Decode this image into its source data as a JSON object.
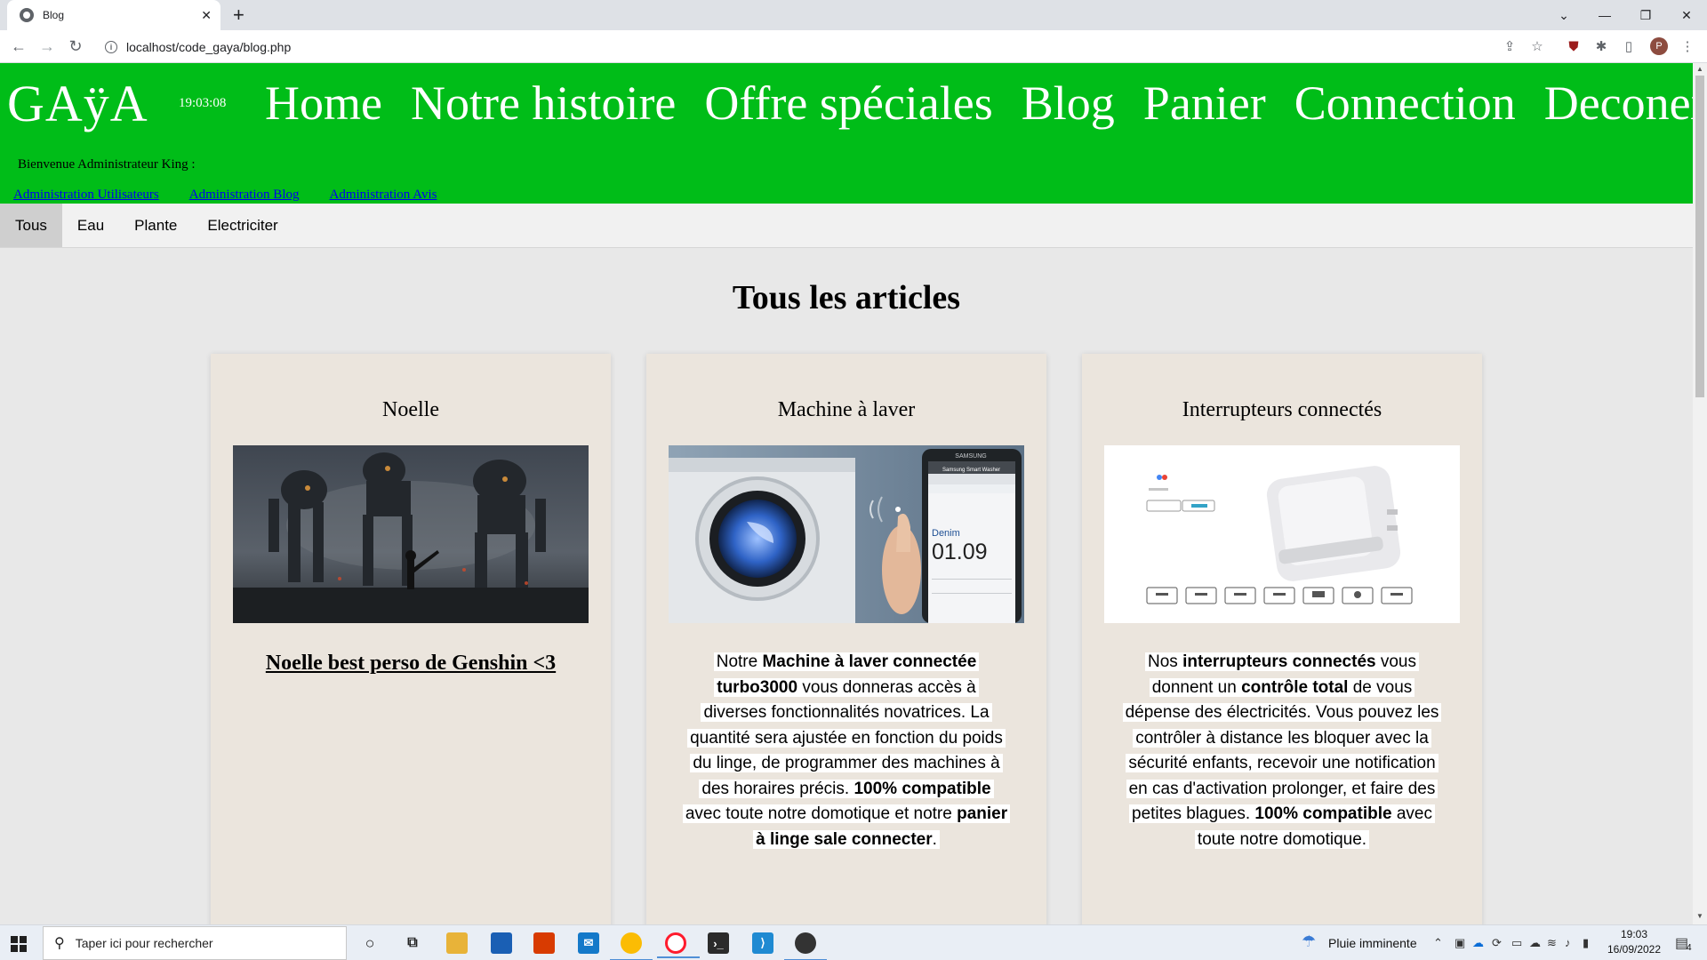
{
  "browser": {
    "tab_title": "Blog",
    "url": "localhost/code_gaya/blog.php",
    "avatar_letter": "P"
  },
  "site": {
    "logo": "GAÿA",
    "clock": "19:03:08",
    "nav": [
      "Home",
      "Notre histoire",
      "Offre spéciales",
      "Blog",
      "Panier",
      "Connection",
      "Deconexion"
    ],
    "welcome": "Bienvenue Administrateur King :",
    "admin_links": [
      "Administration Utilisateurs",
      "Administration Blog",
      "Administration Avis"
    ],
    "filters": [
      "Tous",
      "Eau",
      "Plante",
      "Electriciter"
    ],
    "active_filter": "Tous",
    "page_title": "Tous les articles"
  },
  "cards": [
    {
      "title": "Noelle",
      "image": "dark-fantasy-robots-illustration",
      "link": "Noelle best perso de Genshin <3"
    },
    {
      "title": "Machine à laver",
      "image": "washing-machine-with-smartphone",
      "text_segments": [
        {
          "t": "Notre ",
          "b": false
        },
        {
          "t": "Machine à laver connectée turbo3000",
          "b": true
        },
        {
          "t": " vous donneras accès à diverses fonctionnalités novatrices. La quantité sera ajustée en fonction du poids du linge, de programmer des machines à des horaires précis. ",
          "b": false
        },
        {
          "t": "100% compatible",
          "b": true
        },
        {
          "t": " avec toute notre domotique et notre ",
          "b": false
        },
        {
          "t": "panier à linge sale connecter",
          "b": true
        },
        {
          "t": ".",
          "b": false
        }
      ],
      "phone_brand": "SAMSUNG",
      "phone_app": "Samsung Smart Washer",
      "phone_program": "Denim",
      "phone_time": "01.09"
    },
    {
      "title": "Interrupteurs connectés",
      "image": "smart-switch-product",
      "text_segments": [
        {
          "t": "Nos ",
          "b": false
        },
        {
          "t": "interrupteurs connectés",
          "b": true
        },
        {
          "t": " vous donnent un ",
          "b": false
        },
        {
          "t": "contrôle total",
          "b": true
        },
        {
          "t": " de vous dépense des électricités. Vous pouvez les contrôler à distance les bloquer avec la sécurité enfants, recevoir une notification en cas d'activation prolonger, et faire des petites blagues. ",
          "b": false
        },
        {
          "t": "100% compatible",
          "b": true
        },
        {
          "t": " avec toute notre domotique.",
          "b": false
        }
      ]
    }
  ],
  "taskbar": {
    "search_placeholder": "Taper ici pour rechercher",
    "weather": "Pluie imminente",
    "time": "19:03",
    "date": "16/09/2022",
    "notifications": "4"
  }
}
